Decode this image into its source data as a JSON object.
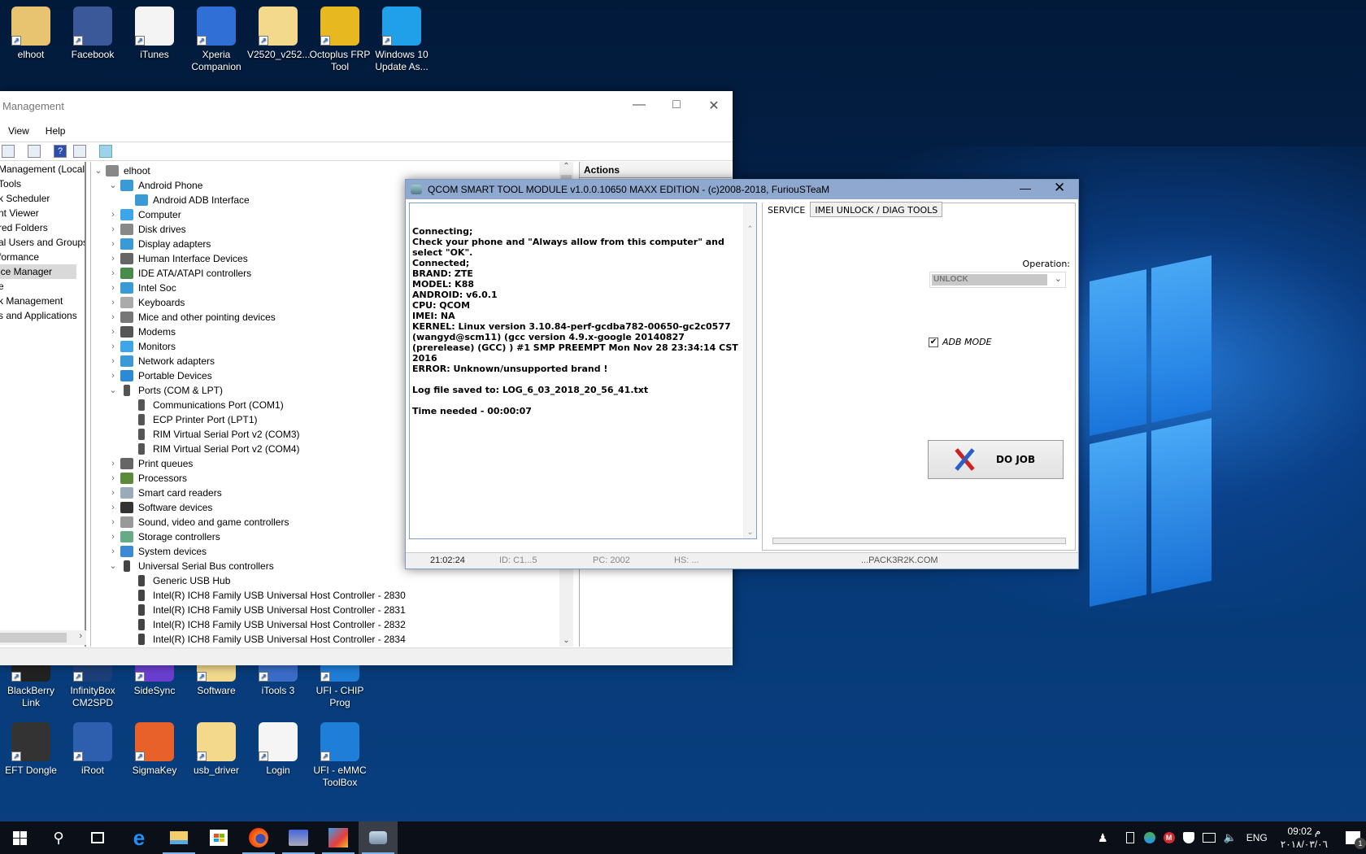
{
  "desktop": {
    "top_icons": [
      {
        "label": "elhoot",
        "icon": "user-folder-icon",
        "color": "#e8c470"
      },
      {
        "label": "Facebook",
        "icon": "facebook-icon",
        "color": "#3b5998"
      },
      {
        "label": "iTunes",
        "icon": "itunes-icon",
        "color": "#f4f4f4"
      },
      {
        "label": "Xperia Companion",
        "icon": "xperia-icon",
        "color": "#2f6fd6"
      },
      {
        "label": "V2520_v252...",
        "icon": "folder-icon",
        "color": "#f2d98c"
      },
      {
        "label": "Octoplus FRP Tool",
        "icon": "octoplus-icon",
        "color": "#e8b820"
      },
      {
        "label": "Windows 10 Update As...",
        "icon": "windows-update-icon",
        "color": "#1fa0e8"
      }
    ],
    "bottom_row1": [
      {
        "label": "BlackBerry Link",
        "icon": "blackberry-icon",
        "color": "#222222"
      },
      {
        "label": "InfinityBox CM2SPD",
        "icon": "infinitybox-icon",
        "color": "#1d3f7a"
      },
      {
        "label": "SideSync",
        "icon": "sidesync-icon",
        "color": "#6a3fd0"
      },
      {
        "label": "Software",
        "icon": "folder-icon",
        "color": "#f2d98c"
      },
      {
        "label": "iTools 3",
        "icon": "itools-icon",
        "color": "#3a6cc8"
      },
      {
        "label": "UFI - CHIP Prog",
        "icon": "ufi-icon",
        "color": "#1f7ed8"
      }
    ],
    "bottom_row2": [
      {
        "label": "EFT Dongle",
        "icon": "eft-dongle-icon",
        "color": "#333333"
      },
      {
        "label": "iRoot",
        "icon": "iroot-icon",
        "color": "#2e5fae"
      },
      {
        "label": "SigmaKey",
        "icon": "sigmakey-icon",
        "color": "#e8602a"
      },
      {
        "label": "usb_driver",
        "icon": "folder-icon",
        "color": "#f2d98c"
      },
      {
        "label": "Login",
        "icon": "text-file-icon",
        "color": "#f5f5f5"
      },
      {
        "label": "UFI - eMMC ToolBox",
        "icon": "ufi-icon",
        "color": "#1f7ed8"
      }
    ]
  },
  "computer_management": {
    "title": "Management",
    "menu": [
      "View",
      "Help"
    ],
    "left_tree": [
      "Management (Local",
      " Tools",
      "k Scheduler",
      "nt Viewer",
      "red Folders",
      "al Users and Groups",
      "formance",
      "ice Manager",
      "e",
      "k Management",
      "s and Applications"
    ],
    "left_selected_index": 7,
    "root": "elhoot",
    "devices": [
      {
        "label": "Android Phone",
        "level": 1,
        "expanded": true,
        "icon": "display-adapter-icon"
      },
      {
        "label": "Android ADB Interface",
        "level": 2,
        "icon": "display-adapter-icon"
      },
      {
        "label": "Computer",
        "level": 1,
        "icon": "monitor-icon"
      },
      {
        "label": "Disk drives",
        "level": 1,
        "icon": "disk-drive-icon"
      },
      {
        "label": "Display adapters",
        "level": 1,
        "icon": "display-adapter-icon"
      },
      {
        "label": "Human Interface Devices",
        "level": 1,
        "icon": "hid-icon"
      },
      {
        "label": "IDE ATA/ATAPI controllers",
        "level": 1,
        "icon": "ide-icon"
      },
      {
        "label": "Intel Soc",
        "level": 1,
        "icon": "network-icon"
      },
      {
        "label": "Keyboards",
        "level": 1,
        "icon": "keyboard-icon"
      },
      {
        "label": "Mice and other pointing devices",
        "level": 1,
        "icon": "mouse-icon"
      },
      {
        "label": "Modems",
        "level": 1,
        "icon": "modem-icon"
      },
      {
        "label": "Monitors",
        "level": 1,
        "icon": "monitor-icon"
      },
      {
        "label": "Network adapters",
        "level": 1,
        "icon": "network-icon"
      },
      {
        "label": "Portable Devices",
        "level": 1,
        "icon": "portable-device-icon"
      },
      {
        "label": "Ports (COM & LPT)",
        "level": 1,
        "expanded": true,
        "icon": "port-icon"
      },
      {
        "label": "Communications Port (COM1)",
        "level": 2,
        "icon": "port-icon"
      },
      {
        "label": "ECP Printer Port (LPT1)",
        "level": 2,
        "icon": "port-icon"
      },
      {
        "label": "RIM Virtual Serial Port v2 (COM3)",
        "level": 2,
        "icon": "port-icon"
      },
      {
        "label": "RIM Virtual Serial Port v2 (COM4)",
        "level": 2,
        "icon": "port-icon"
      },
      {
        "label": "Print queues",
        "level": 1,
        "icon": "printer-icon"
      },
      {
        "label": "Processors",
        "level": 1,
        "icon": "processor-icon"
      },
      {
        "label": "Smart card readers",
        "level": 1,
        "icon": "smart-card-icon"
      },
      {
        "label": "Software devices",
        "level": 1,
        "icon": "software-device-icon"
      },
      {
        "label": "Sound, video and game controllers",
        "level": 1,
        "icon": "speaker-icon"
      },
      {
        "label": "Storage controllers",
        "level": 1,
        "icon": "storage-icon"
      },
      {
        "label": "System devices",
        "level": 1,
        "icon": "system-icon"
      },
      {
        "label": "Universal Serial Bus controllers",
        "level": 1,
        "expanded": true,
        "icon": "usb-icon"
      },
      {
        "label": "Generic USB Hub",
        "level": 2,
        "icon": "usb-icon"
      },
      {
        "label": "Intel(R) ICH8 Family USB Universal Host Controller - 2830",
        "level": 2,
        "icon": "usb-icon"
      },
      {
        "label": "Intel(R) ICH8 Family USB Universal Host Controller - 2831",
        "level": 2,
        "icon": "usb-icon"
      },
      {
        "label": "Intel(R) ICH8 Family USB Universal Host Controller - 2832",
        "level": 2,
        "icon": "usb-icon"
      },
      {
        "label": "Intel(R) ICH8 Family USB Universal Host Controller - 2834",
        "level": 2,
        "icon": "usb-icon"
      }
    ],
    "actions_header": "Actions"
  },
  "qcom": {
    "title": "QCOM SMART TOOL MODULE v1.0.0.10650 MAXX EDITION - (c)2008-2018, FuriouSTeaM",
    "log": "Connecting;\nCheck your phone and \"Always allow from this computer\" and select \"OK\".\nConnected;\nBRAND: ZTE\nMODEL: K88\nANDROID: v6.0.1\nCPU: QCOM\nIMEI: NA\nKERNEL: Linux version 3.10.84-perf-gcdba782-00650-gc2c0577 (wangyd@scm11) (gcc version 4.9.x-google 20140827 (prerelease) (GCC) ) #1 SMP PREEMPT Mon Nov 28 23:34:14 CST 2016\nERROR: Unknown/unsupported brand !\n\nLog file saved to: LOG_6_03_2018_20_56_41.txt\n\nTime needed - 00:00:07",
    "tabs": [
      "SERVICE",
      "IMEI UNLOCK / DIAG TOOLS"
    ],
    "active_tab": 0,
    "operation_label": "Operation:",
    "operation_value": "UNLOCK",
    "adb_mode_label": "ADB MODE",
    "adb_mode_checked": true,
    "do_job_label": "DO JOB",
    "progress": 0,
    "status": {
      "time": "21:02:24",
      "id": "ID: C1...5",
      "pc": "PC: 2002",
      "hs": "HS: ...",
      "site": "...PACK3R2K.COM"
    }
  },
  "taskbar": {
    "apps": [
      "start-icon",
      "search-icon",
      "task-view-icon",
      "edge-icon",
      "file-explorer-icon",
      "store-icon",
      "firefox-icon",
      "network-tool-icon",
      "candy-crush-icon",
      "qcom-tool-icon"
    ],
    "language": "ENG",
    "time": "09:02 م",
    "date": "٢٠١٨/٠٣/٠٦",
    "notification_count": "1"
  }
}
